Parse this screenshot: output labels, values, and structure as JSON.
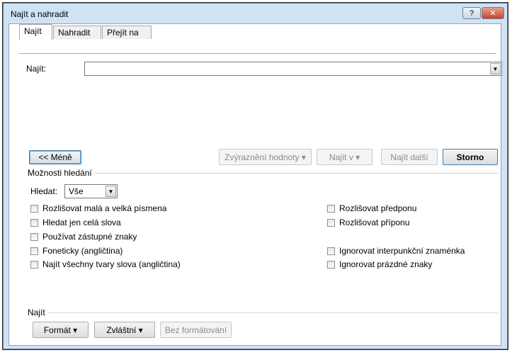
{
  "window": {
    "title": "Najít a nahradit",
    "help_label": "?",
    "close_label": "✕"
  },
  "tabs": [
    {
      "label": "Najít",
      "active": true
    },
    {
      "label": "Nahradit",
      "active": false
    },
    {
      "label": "Přejít na",
      "active": false
    }
  ],
  "find": {
    "label": "Najít:",
    "value": ""
  },
  "buttons": {
    "less": "<< Méně",
    "highlight": "Zvýraznění hodnoty ▾",
    "find_in": "Najít v ▾",
    "find_next": "Najít další",
    "cancel": "Storno"
  },
  "options": {
    "section_label": "Možnosti hledání",
    "search_label": "Hledat:",
    "search_value": "Vše",
    "left": [
      {
        "label": "Rozlišovat malá a velká písmena",
        "checked": false
      },
      {
        "label": "Hledat jen celá slova",
        "checked": false
      },
      {
        "label": "Používat zástupné znaky",
        "checked": false
      },
      {
        "label": "Foneticky (angličtina)",
        "checked": false
      },
      {
        "label": "Najít všechny tvary slova (angličtina)",
        "checked": false
      }
    ],
    "right_top": [
      {
        "label": "Rozlišovat předponu",
        "checked": false
      },
      {
        "label": "Rozlišovat příponu",
        "checked": false
      }
    ],
    "right_bottom": [
      {
        "label": "Ignorovat interpunkční znaménka",
        "checked": false
      },
      {
        "label": "Ignorovat prázdné znaky",
        "checked": false
      }
    ]
  },
  "find_section": {
    "label": "Najít",
    "format": "Formát ▾",
    "special": "Zvláštní ▾",
    "no_format": "Bez formátování"
  }
}
